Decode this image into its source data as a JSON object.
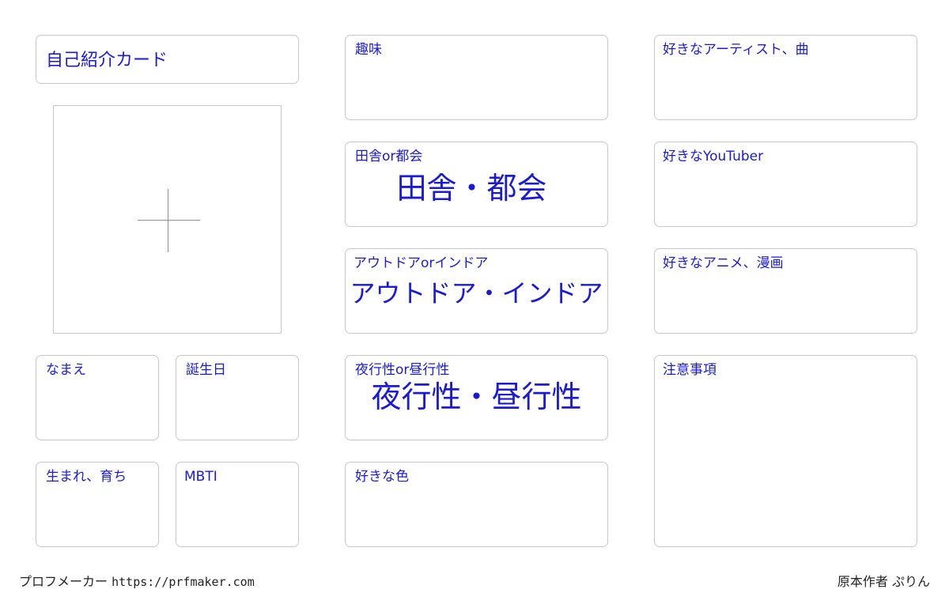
{
  "card": {
    "title": "自己紹介カード",
    "photo": {
      "icon": "crosshair-icon"
    }
  },
  "left": {
    "name_label": "なまえ",
    "birthday_label": "誕生日",
    "origin_label": "生まれ、育ち",
    "mbti_label": "MBTI"
  },
  "middle": {
    "hobby_label": "趣味",
    "countryside_city": {
      "label": "田舎or都会",
      "choice": "田舎・都会"
    },
    "outdoor_indoor": {
      "label": "アウトドアorインドア",
      "choice": "アウトドア・インドア"
    },
    "nocturnal_diurnal": {
      "label": "夜行性or昼行性",
      "choice": "夜行性・昼行性"
    },
    "favorite_color_label": "好きな色"
  },
  "right": {
    "artist_song_label": "好きなアーティスト、曲",
    "youtuber_label": "好きなYouTuber",
    "anime_manga_label": "好きなアニメ、漫画",
    "notes_label": "注意事項"
  },
  "footer": {
    "brand": "プロフメーカー",
    "url": "https://prfmaker.com",
    "author": "原本作者 ぷりん"
  },
  "colors": {
    "text_accent": "#1a1ad6",
    "border": "#c8c8c8"
  }
}
